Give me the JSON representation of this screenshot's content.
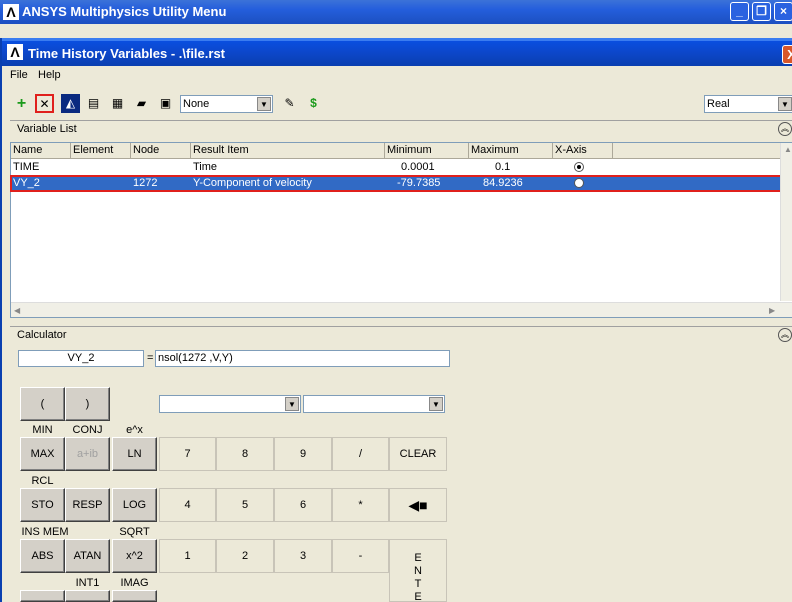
{
  "background_window": {
    "title": "ANSYS Multiphysics Utility Menu",
    "logo": "ansys-logo"
  },
  "window": {
    "title": "Time History Variables - .\\file.rst",
    "close": "X"
  },
  "menubar": {
    "items": [
      "File",
      "Help"
    ]
  },
  "toolbar": {
    "buttons": [
      "add-data-icon",
      "delete-data-icon",
      "graph-data-icon",
      "list-data-icon",
      "properties-icon",
      "open-file-icon",
      "save-file-icon",
      "clear-icon",
      "overlay-data-icon"
    ],
    "selected_button": "delete-data-icon",
    "combo_value": "None",
    "mode_value": "Real"
  },
  "variable_list": {
    "label": "Variable List",
    "columns": [
      "Name",
      "Element",
      "Node",
      "Result Item",
      "Minimum",
      "Maximum",
      "X-Axis"
    ],
    "rows": [
      {
        "name": "TIME",
        "element": "",
        "node": "",
        "result_item": "Time",
        "minimum": "0.0001",
        "maximum": "0.1",
        "x_axis": true
      },
      {
        "name": "VY_2",
        "element": "",
        "node": "1272",
        "result_item": "Y-Component of velocity",
        "minimum": "-79.7385",
        "maximum": "84.9236",
        "x_axis": false
      }
    ],
    "selected_row": 1
  },
  "calculator": {
    "label": "Calculator",
    "variable_name": "VY_2",
    "equals": "=",
    "expression": "nsol(1272 ,V,Y)",
    "buttons": {
      "lparen": "(",
      "rparen": ")",
      "min": "MIN",
      "conj": "CONJ",
      "ex": "e^x",
      "max": "MAX",
      "aib": "a+ib",
      "ln": "LN",
      "d7": "7",
      "d8": "8",
      "d9": "9",
      "div": "/",
      "clear": "CLEAR",
      "rcl": "RCL",
      "sto": "STO",
      "resp": "RESP",
      "log": "LOG",
      "d4": "4",
      "d5": "5",
      "d6": "6",
      "mul": "*",
      "insmem": "INS MEM",
      "sqrt": "SQRT",
      "abs": "ABS",
      "atan": "ATAN",
      "x2": "x^2",
      "d1": "1",
      "d2": "2",
      "d3": "3",
      "sub": "-",
      "int1": "INT1",
      "imag": "IMAG",
      "enter": "E N T E"
    }
  },
  "colors": {
    "title_blue": "#0a4fe0",
    "selection": "#316ac5",
    "highlight_red": "#e0201c"
  }
}
